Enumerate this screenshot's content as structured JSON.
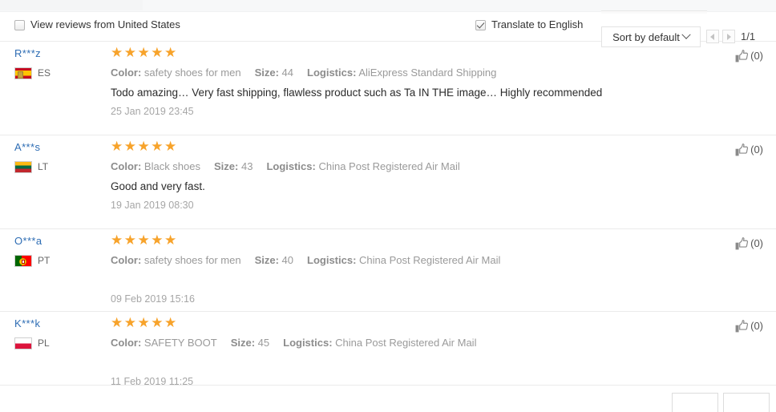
{
  "toolbar": {
    "view_country_label": "View reviews from United States",
    "view_country_checked": false,
    "translate_label": "Translate to English",
    "translate_checked": true,
    "sort_label": "Sort by default",
    "page_indicator": "1/1",
    "prev_icon": "triangle-left-icon",
    "next_icon": "triangle-right-icon"
  },
  "labels": {
    "color": "Color:",
    "size": "Size:",
    "logistics": "Logistics:"
  },
  "reviews": [
    {
      "name": "R***z",
      "country_code": "ES",
      "flag": "flag-es",
      "stars": "★★★★★",
      "rating": 5,
      "color": "safety shoes for men",
      "size": "44",
      "logistics": "AliExpress Standard Shipping",
      "text": "Todo amazing… Very fast shipping, flawless product such as Ta IN THE image… Highly recommended",
      "date": "25 Jan 2019 23:45",
      "helpful": "(0)"
    },
    {
      "name": "A***s",
      "country_code": "LT",
      "flag": "flag-lt",
      "stars": "★★★★★",
      "rating": 5,
      "color": "Black shoes",
      "size": "43",
      "logistics": "China Post Registered Air Mail",
      "text": "Good and very fast.",
      "date": "19 Jan 2019 08:30",
      "helpful": "(0)"
    },
    {
      "name": "O***a",
      "country_code": "PT",
      "flag": "flag-pt",
      "stars": "★★★★★",
      "rating": 5,
      "color": "safety shoes for men",
      "size": "40",
      "logistics": "China Post Registered Air Mail",
      "text": "",
      "date": "09 Feb 2019 15:16",
      "helpful": "(0)"
    },
    {
      "name": "K***k",
      "country_code": "PL",
      "flag": "flag-pl",
      "stars": "★★★★★",
      "rating": 5,
      "color": "SAFETY BOOT",
      "size": "45",
      "logistics": "China Post Registered Air Mail",
      "text": "",
      "date": "11 Feb 2019 11:25",
      "helpful": "(0)"
    }
  ],
  "colors": {
    "star": "#f7a32b",
    "link": "#2e6db4",
    "muted": "#9a9a9a",
    "divider": "#ebebeb"
  }
}
